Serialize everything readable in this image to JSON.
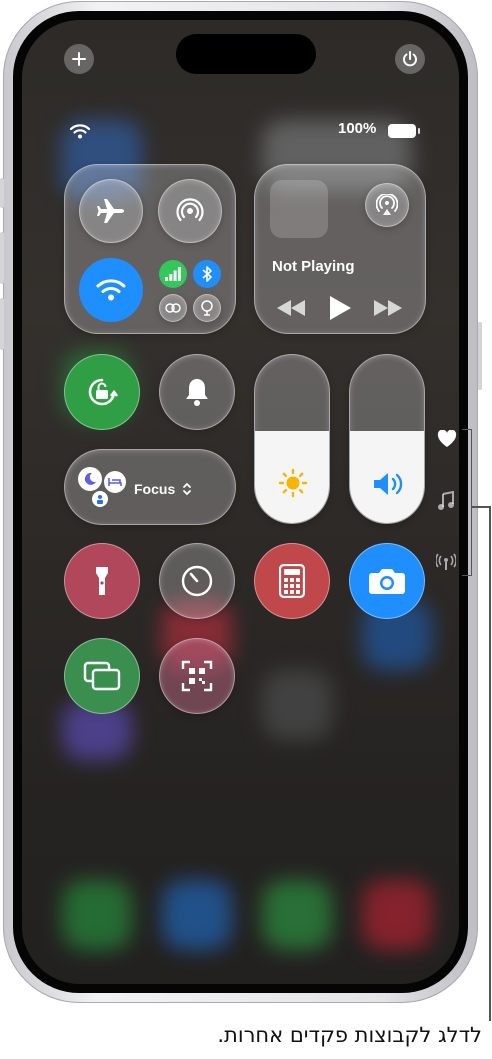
{
  "status_bar": {
    "battery_percent": "100%",
    "wifi_icon": "wifi-icon",
    "battery_icon": "battery-icon"
  },
  "corner_buttons": {
    "add_icon": "plus-icon",
    "power_icon": "power-icon"
  },
  "connectivity": {
    "airplane": {
      "icon": "airplane-icon",
      "on": false
    },
    "airdrop": {
      "icon": "airdrop-icon",
      "on": false
    },
    "wifi": {
      "icon": "wifi-icon",
      "on": true,
      "color": "#1f8fff"
    },
    "cellular": {
      "icon": "cellular-icon",
      "on": true,
      "color": "#34c759"
    },
    "bluetooth": {
      "icon": "bluetooth-icon",
      "on": true,
      "color": "#1f8fff"
    },
    "personal_hotspot": {
      "icon": "hotspot-icon",
      "on": false
    },
    "vpn": {
      "icon": "vpn-icon",
      "on": false
    }
  },
  "now_playing": {
    "title": "Not Playing",
    "airplay_icon": "airplay-icon"
  },
  "orientation_lock": {
    "icon": "rotation-lock-icon",
    "color": "#2f9e44"
  },
  "silent_mode": {
    "icon": "bell-icon"
  },
  "brightness": {
    "level": 0.55,
    "icon": "sun-icon"
  },
  "volume": {
    "level": 0.55,
    "icon": "speaker-icon"
  },
  "focus": {
    "label": "Focus"
  },
  "flashlight": {
    "icon": "flashlight-icon"
  },
  "timer": {
    "icon": "timer-icon"
  },
  "calculator": {
    "icon": "calculator-icon"
  },
  "camera": {
    "icon": "camera-icon",
    "color": "#1f8fff"
  },
  "screen_mirroring": {
    "icon": "screen-mirroring-icon"
  },
  "code_scanner": {
    "icon": "qr-scanner-icon"
  },
  "page_indicators": {
    "favorites": "heart-icon",
    "music": "music-note-icon",
    "connectivity": "antenna-icon"
  },
  "caption": "לדלג לקבוצות פקדים אחרות."
}
